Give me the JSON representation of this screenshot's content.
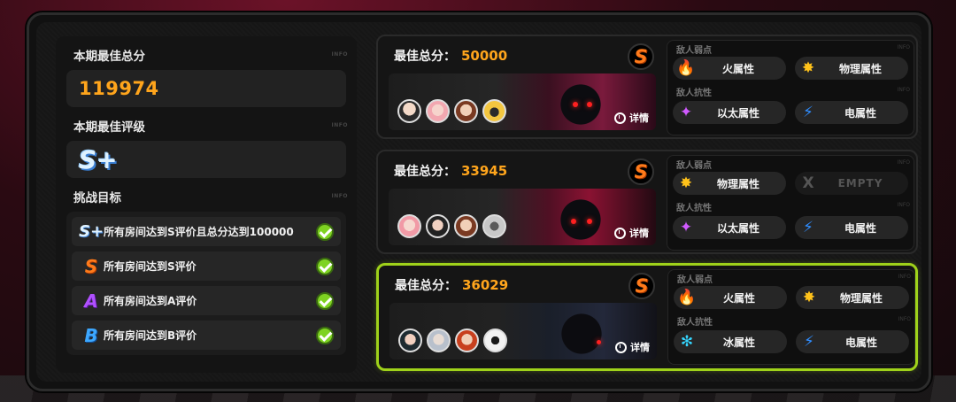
{
  "left": {
    "best_score_title": "本期最佳总分",
    "best_score_value": "119974",
    "best_rank_title": "本期最佳评级",
    "best_rank_value": "S+",
    "goals_title": "挑战目标",
    "info_tag": "INFO",
    "goals": [
      {
        "badge": "S+",
        "text": "所有房间达到S评价且总分达到100000",
        "done": true
      },
      {
        "badge": "S",
        "text": "所有房间达到S评价",
        "done": true
      },
      {
        "badge": "A",
        "text": "所有房间达到A评价",
        "done": true
      },
      {
        "badge": "B",
        "text": "所有房间达到B评价",
        "done": true
      }
    ]
  },
  "rooms": [
    {
      "score_label": "最佳总分：",
      "score": "50000",
      "rank": "S",
      "detail": "详情",
      "weak_label": "敌人弱点",
      "resist_label": "敌人抗性",
      "weak": [
        {
          "icon": "fire-icon",
          "glyph": "🔥",
          "color": "#ff5a1a",
          "name": "火属性"
        },
        {
          "icon": "physical-icon",
          "glyph": "✸",
          "color": "#ffc21a",
          "name": "物理属性"
        }
      ],
      "resist": [
        {
          "icon": "ether-icon",
          "glyph": "✦",
          "color": "#d05aff",
          "name": "以太属性"
        },
        {
          "icon": "electric-icon",
          "glyph": "⚡",
          "color": "#2f8dff",
          "name": "电属性"
        }
      ],
      "active": false
    },
    {
      "score_label": "最佳总分：",
      "score": "33945",
      "rank": "S",
      "detail": "详情",
      "weak_label": "敌人弱点",
      "resist_label": "敌人抗性",
      "weak": [
        {
          "icon": "physical-icon",
          "glyph": "✸",
          "color": "#ffc21a",
          "name": "物理属性"
        },
        {
          "icon": "empty-icon",
          "glyph": "X",
          "color": "#555555",
          "name": "EMPTY"
        }
      ],
      "resist": [
        {
          "icon": "ether-icon",
          "glyph": "✦",
          "color": "#d05aff",
          "name": "以太属性"
        },
        {
          "icon": "electric-icon",
          "glyph": "⚡",
          "color": "#2f8dff",
          "name": "电属性"
        }
      ],
      "active": false
    },
    {
      "score_label": "最佳总分：",
      "score": "36029",
      "rank": "S",
      "detail": "详情",
      "weak_label": "敌人弱点",
      "resist_label": "敌人抗性",
      "weak": [
        {
          "icon": "fire-icon",
          "glyph": "🔥",
          "color": "#ff5a1a",
          "name": "火属性"
        },
        {
          "icon": "physical-icon",
          "glyph": "✸",
          "color": "#ffc21a",
          "name": "物理属性"
        }
      ],
      "resist": [
        {
          "icon": "ice-icon",
          "glyph": "✻",
          "color": "#35d6ff",
          "name": "冰属性"
        },
        {
          "icon": "electric-icon",
          "glyph": "⚡",
          "color": "#2f8dff",
          "name": "电属性"
        }
      ],
      "active": true
    }
  ],
  "colors": {
    "score_orange": "#ffa51c",
    "active_border": "#9fd21a",
    "check_green": "#7ed321"
  }
}
